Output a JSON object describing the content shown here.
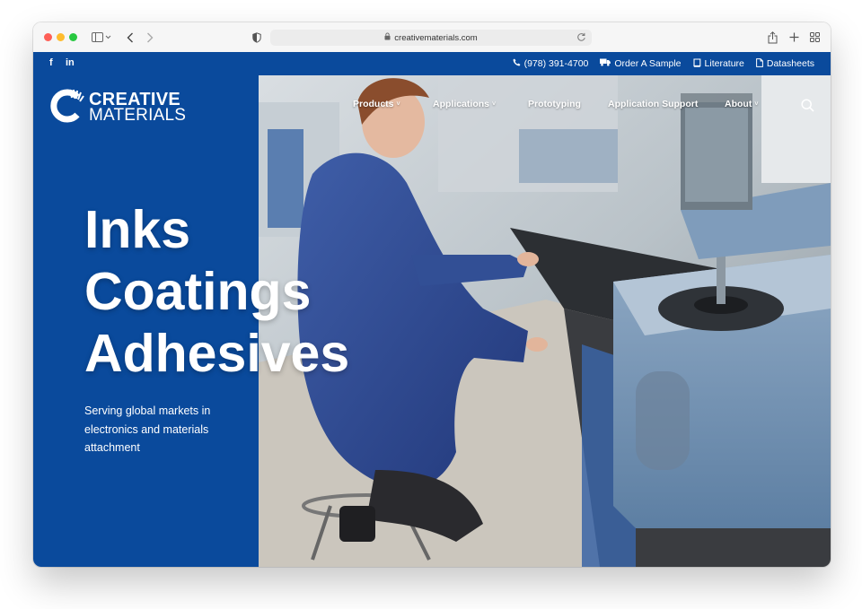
{
  "browser": {
    "url": "creativematerials.com"
  },
  "utility_bar": {
    "social": [
      "f",
      "in"
    ],
    "links": [
      {
        "label": "(978) 391-4700",
        "icon": "phone-icon"
      },
      {
        "label": "Order A Sample",
        "icon": "truck-icon"
      },
      {
        "label": "Literature",
        "icon": "book-icon"
      },
      {
        "label": "Datasheets",
        "icon": "document-icon"
      }
    ]
  },
  "logo": {
    "line1": "CREATIVE",
    "line2": "MATERIALS"
  },
  "nav": {
    "items": [
      {
        "label": "Products",
        "has_dropdown": true
      },
      {
        "label": "Applications",
        "has_dropdown": true
      },
      {
        "label": "Prototyping",
        "has_dropdown": false
      },
      {
        "label": "Application Support",
        "has_dropdown": false
      },
      {
        "label": "About",
        "has_dropdown": true
      }
    ]
  },
  "hero": {
    "headline": [
      "Inks",
      "Coatings",
      "Adhesives"
    ],
    "tagline": "Serving global markets in electronics and materials attachment"
  },
  "colors": {
    "brand_blue": "#0a4a9c",
    "white": "#ffffff"
  }
}
